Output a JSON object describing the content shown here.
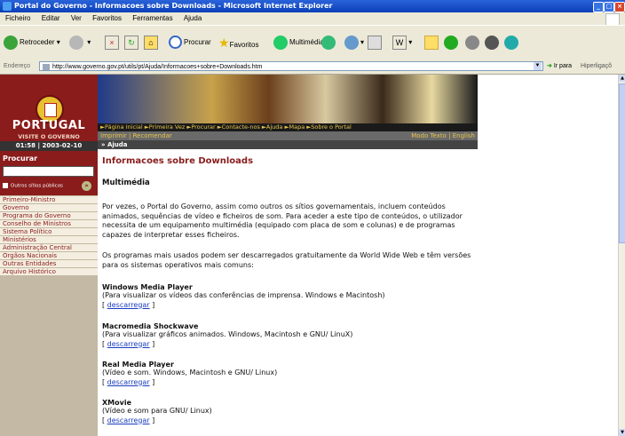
{
  "window": {
    "title": "Portal do Governo - Informacoes sobre Downloads - Microsoft Internet Explorer"
  },
  "menu": [
    "Ficheiro",
    "Editar",
    "Ver",
    "Favoritos",
    "Ferramentas",
    "Ajuda"
  ],
  "toolbar": {
    "back": "Retroceder",
    "search": "Procurar",
    "favorites": "Favoritos",
    "media": "Multimédia"
  },
  "address": {
    "label": "Endereço",
    "url": "http://www.governo.gov.pt/utils/pt/Ajuda/Informacoes+sobre+Downloads.htm",
    "go": "Ir para",
    "links": "Hiperligaçõ"
  },
  "site": {
    "portugal": "PORTUGAL",
    "visite": "VISITE O GOVERNO",
    "datetime": "01:58 | 2003-02-10",
    "search_label": "Procurar",
    "others": "Outros sítios públicos",
    "top_nav": "►Página Inicial  ►Primeira Vez  ►Procurar  ►Contacte-nos  ►Ajuda  ►Mapa  ►Sobre o Portal",
    "sub_left": "Imprimir | Recomendar",
    "sub_right": "Modo Texto | English",
    "breadcrumb": "» Ajuda",
    "nav": [
      "Primeiro-Ministro",
      "Governo",
      "Programa do Governo",
      "Conselho de Ministros",
      "Sistema Político",
      "Ministérios",
      "Administração Central",
      "Órgãos Nacionais",
      "Outras Entidades",
      "Arquivo Histórico"
    ]
  },
  "main": {
    "title": "Informacoes sobre Downloads",
    "subtitle": "Multimédia",
    "p1": "Por vezes, o Portal do Governo, assim como outros os sítios governamentais, incluem conteúdos animados, sequências de vídeo e ficheiros de som. Para aceder a este tipo de conteúdos, o utilizador necessita de um equipamento multimédia (equipado com placa de som e colunas) e de programas capazes de interpretar esses ficheiros.",
    "p2": "Os programas mais usados podem ser descarregados gratuitamente da World Wide Web e têm versões para os sistemas operativos mais comuns:",
    "products": [
      {
        "name": "Windows Media Player",
        "desc": "(Para visualizar os vídeos das conferências de imprensa. Windows e Macintosh)",
        "link": "descarregar"
      },
      {
        "name": "Macromedia Shockwave",
        "desc": "(Para visualizar gráficos animados. Windows, Macintosh e GNU/ LinuX)",
        "link": "descarregar"
      },
      {
        "name": "Real Media Player",
        "desc": "(Vídeo e som. Windows, Macintosh e GNU/ Linux)",
        "link": "descarregar"
      },
      {
        "name": "XMovie",
        "desc": "(Vídeo e som para GNU/ Linux)",
        "link": "descarregar"
      }
    ]
  }
}
